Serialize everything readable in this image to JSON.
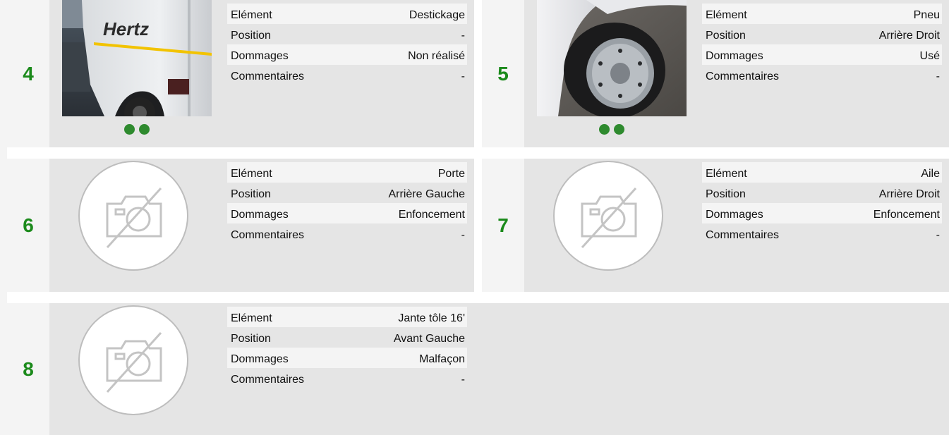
{
  "labels": {
    "element": "Elément",
    "position": "Position",
    "dommages": "Dommages",
    "commentaires": "Commentaires"
  },
  "colors": {
    "number_green": "#1b8a1b",
    "dot_green": "#2e8a2e",
    "card_bg": "#e5e5e5",
    "row_alt_bg": "#f4f4f4"
  },
  "items": [
    {
      "number": "4",
      "element": "Destickage",
      "position": "-",
      "dommages": "Non réalisé",
      "commentaires": "-",
      "photo": "hertz-van-side-photo",
      "photo_dots": 2
    },
    {
      "number": "5",
      "element": "Pneu",
      "position": "Arrière Droit",
      "dommages": "Usé",
      "commentaires": "-",
      "photo": "rear-tire-photo",
      "photo_dots": 2
    },
    {
      "number": "6",
      "element": "Porte",
      "position": "Arrière Gauche",
      "dommages": "Enfoncement",
      "commentaires": "-",
      "photo": "no-photo-icon",
      "photo_dots": 0
    },
    {
      "number": "7",
      "element": "Aile",
      "position": "Arrière Droit",
      "dommages": "Enfoncement",
      "commentaires": "-",
      "photo": "no-photo-icon",
      "photo_dots": 0
    },
    {
      "number": "8",
      "element": "Jante tôle 16'",
      "position": "Avant Gauche",
      "dommages": "Malfaçon",
      "commentaires": "-",
      "photo": "no-photo-icon",
      "photo_dots": 0
    }
  ]
}
